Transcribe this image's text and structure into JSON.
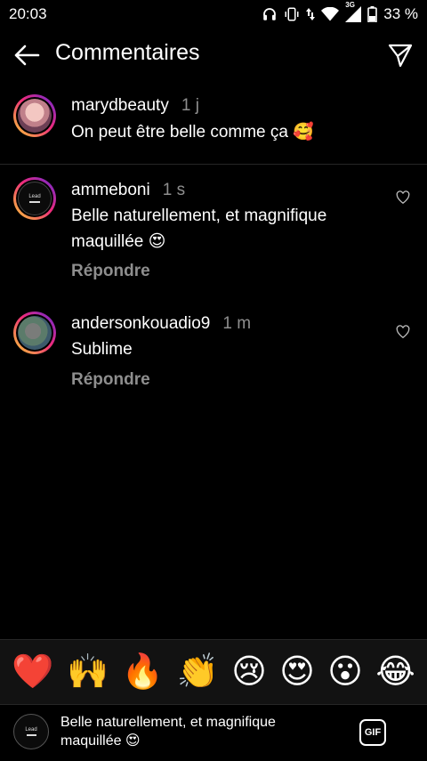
{
  "status": {
    "time": "20:03",
    "network": "3G",
    "battery": "33 %",
    "icons": [
      "headphones-icon",
      "vibrate-icon",
      "data-arrows-icon",
      "wifi-icon",
      "signal-icon",
      "battery-icon"
    ]
  },
  "header": {
    "title": "Commentaires",
    "back_icon": "arrow-left-icon",
    "send_icon": "paper-plane-icon"
  },
  "caption": {
    "username": "marydbeauty",
    "time": "1 j",
    "text": "On peut être belle comme ça 🥰"
  },
  "comments": [
    {
      "username": "ammeboni",
      "time": "1 s",
      "text": "Belle naturellement, et magnifique maquillée 😍",
      "reply_label": "Répondre",
      "avatar_label": "Lead"
    },
    {
      "username": "andersonkouadio9",
      "time": "1 m",
      "text": "Sublime",
      "reply_label": "Répondre"
    }
  ],
  "emoji_bar": [
    "❤️",
    "🙌",
    "🔥",
    "👏",
    "😢",
    "😍",
    "😮",
    "😂"
  ],
  "input": {
    "value": "Belle naturellement, et magnifique\nmaquillée 😍",
    "avatar_label": "Lead",
    "gif_label": "GIF"
  },
  "colors": {
    "background": "#000000",
    "secondary_text": "#8e8e8e",
    "divider": "#262626",
    "emoji_bar_bg": "#121212"
  }
}
